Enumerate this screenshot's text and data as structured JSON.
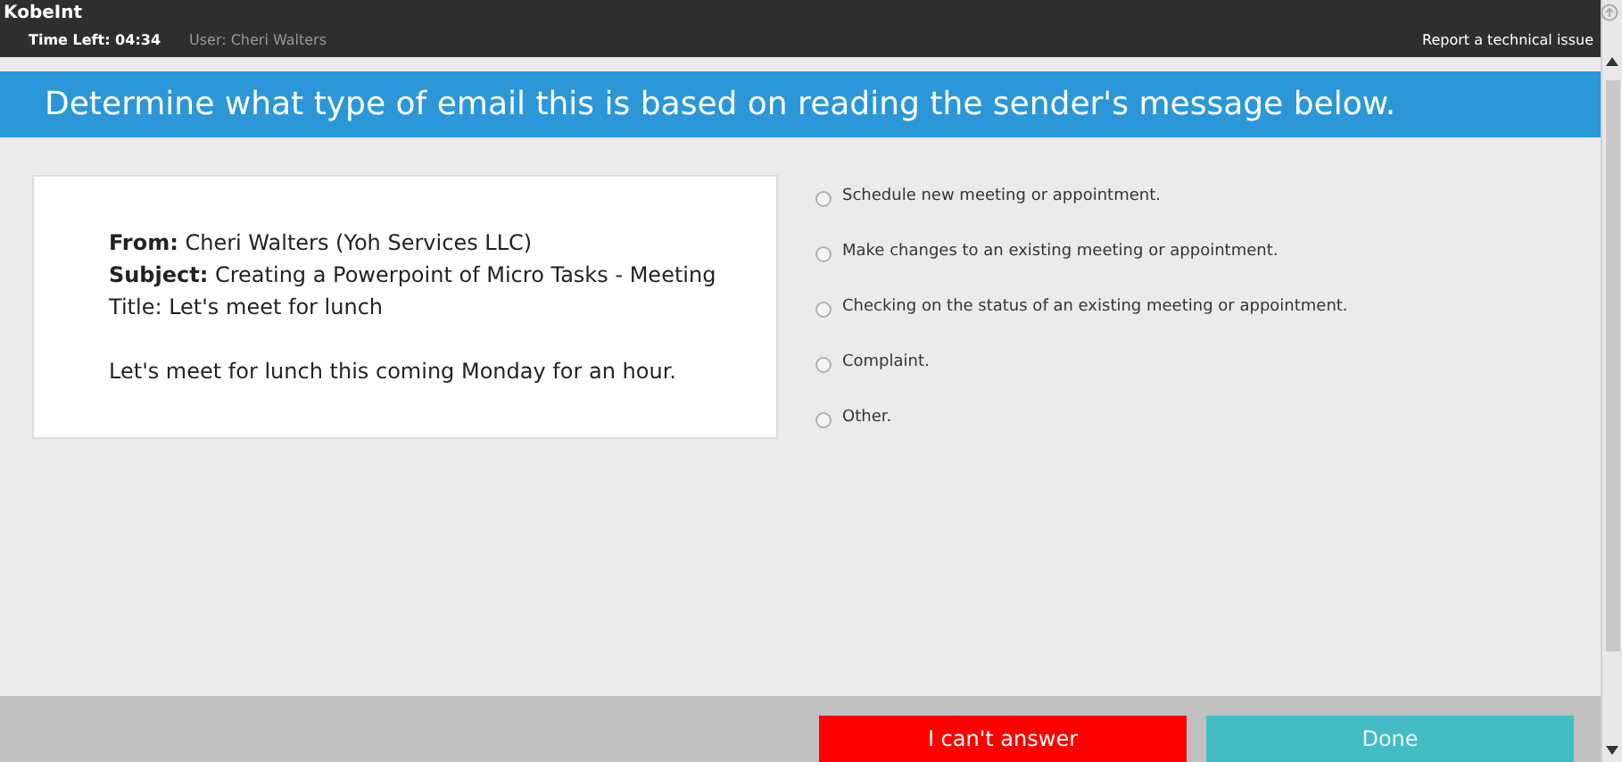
{
  "header": {
    "app_name": "KobeInt",
    "time_left": "Time Left: 04:34",
    "user": "User: Cheri Walters",
    "report_link": "Report a technical issue"
  },
  "banner": {
    "title": "Determine what type of email this is based on reading the sender's message below."
  },
  "email": {
    "from": "**From:** Cheri Walters (Yoh Services LLC)",
    "subject": "**Subject:** Creating a Powerpoint of Micro Tasks - Meeting Title: Let's meet for lunch",
    "body": "Let's meet for lunch this coming Monday for an hour."
  },
  "options": [
    {
      "label": "Schedule new meeting or appointment.",
      "selected": false
    },
    {
      "label": "Make changes to an existing meeting or appointment.",
      "selected": false
    },
    {
      "label": "Checking on the status of an existing meeting or appointment.",
      "selected": false
    },
    {
      "label": "Complaint.",
      "selected": false
    },
    {
      "label": "Other.",
      "selected": false
    }
  ],
  "buttons": [
    {
      "label": "I can't answer",
      "kind": "cant"
    },
    {
      "label": "Done",
      "kind": "done"
    }
  ]
}
